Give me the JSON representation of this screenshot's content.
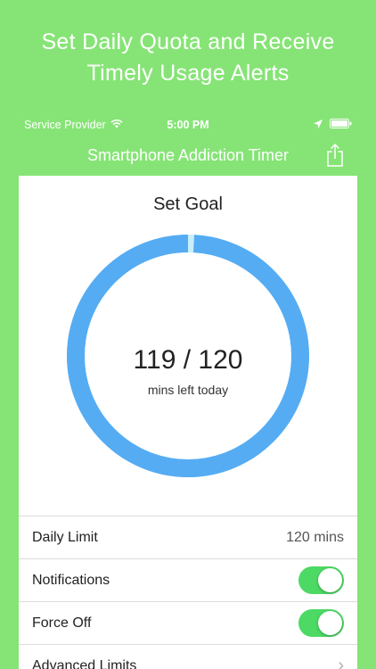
{
  "headline": {
    "line1": "Set Daily Quota and Receive",
    "line2": "Timely Usage Alerts"
  },
  "status_bar": {
    "carrier": "Service Provider",
    "time": "5:00 PM",
    "icons": [
      "wifi-icon",
      "location-arrow-icon",
      "battery-icon"
    ]
  },
  "nav": {
    "title": "Smartphone Addiction Timer",
    "share_icon": "share-icon"
  },
  "goal": {
    "title": "Set Goal",
    "value": "119 / 120",
    "subtitle": "mins left today",
    "remaining": 119,
    "total": 120,
    "ring_color": "#55acf3",
    "used_color": "#c8eefb"
  },
  "settings": {
    "daily_limit_label": "Daily Limit",
    "daily_limit_value": "120 mins",
    "notifications_label": "Notifications",
    "notifications_on": true,
    "force_off_label": "Force Off",
    "force_off_on": true,
    "advanced_limits_label": "Advanced Limits",
    "advanced_chevron": "›"
  },
  "colors": {
    "brand_green": "#86e476",
    "toggle_green": "#4cd964"
  }
}
